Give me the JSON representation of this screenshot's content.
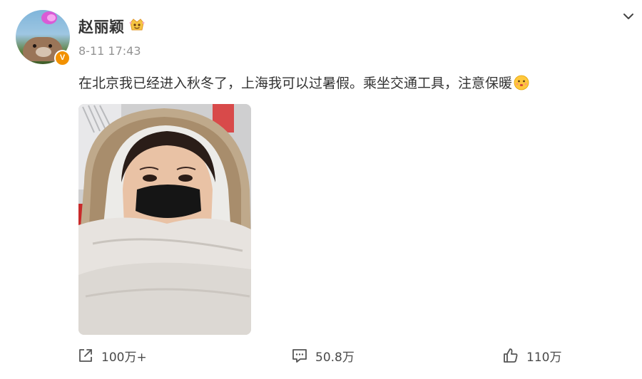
{
  "post": {
    "username": "赵丽颖",
    "timestamp": "8-11 17:43",
    "text": "在北京我已经进入秋冬了，上海我可以过暑假。乘坐交通工具，注意保暖",
    "verified_mark": "V"
  },
  "icons": {
    "member": "member-badge-icon",
    "menu": "chevron-down-icon",
    "emoji": "thinking-face-emoji",
    "repost": "share-icon",
    "comment": "comment-icon",
    "like": "thumbs-up-icon"
  },
  "actions": {
    "repost_count": "100万+",
    "comment_count": "50.8万",
    "like_count": "110万"
  },
  "colors": {
    "verified": "#f29100",
    "username": "#333333",
    "timestamp": "#939393"
  }
}
